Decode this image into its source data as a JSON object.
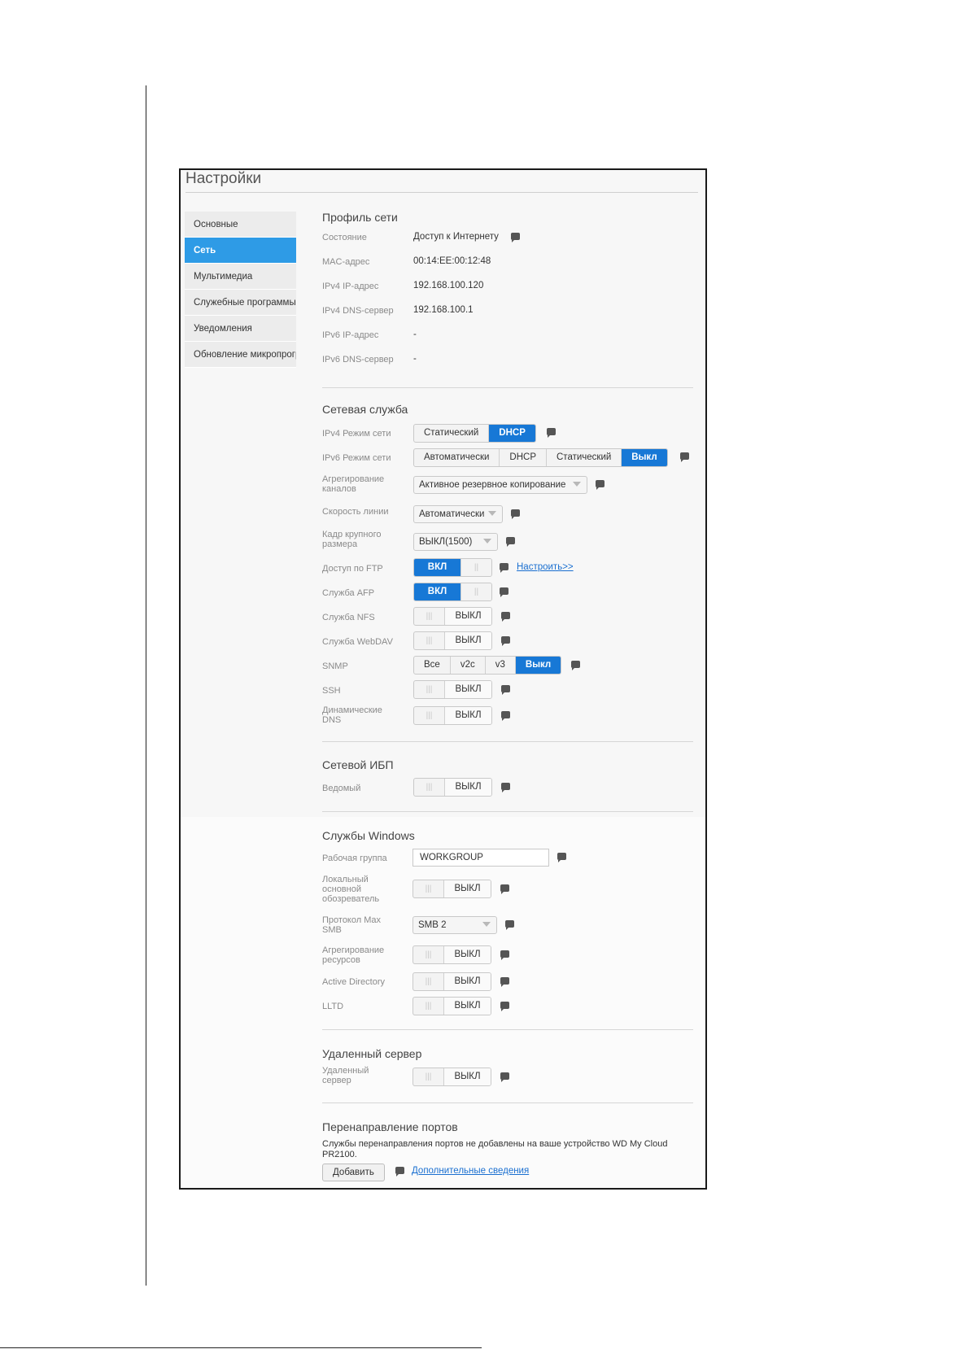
{
  "page_title": "Настройки",
  "sidebar": {
    "items": [
      {
        "label": "Основные"
      },
      {
        "label": "Сеть"
      },
      {
        "label": "Мультимедиа"
      },
      {
        "label": "Служебные программы"
      },
      {
        "label": "Уведомления"
      },
      {
        "label": "Обновление микропрограммы"
      }
    ],
    "active": "Сеть"
  },
  "network_profile": {
    "title": "Профиль сети",
    "rows": [
      {
        "label": "Состояние",
        "value": "Доступ к Интернету"
      },
      {
        "label": "MAC-адрес",
        "value": "00:14:EE:00:12:48"
      },
      {
        "label": "IPv4 IP-адрес",
        "value": "192.168.100.120"
      },
      {
        "label": "IPv4 DNS-сервер",
        "value": "192.168.100.1"
      },
      {
        "label": "IPv6 IP-адрес",
        "value": "-"
      },
      {
        "label": "IPv6 DNS-сервер",
        "value": "-"
      }
    ]
  },
  "network_service": {
    "title": "Сетевая служба",
    "ipv4_mode": {
      "label": "IPv4 Режим сети",
      "options": [
        "Статический",
        "DHCP"
      ],
      "selected": "DHCP"
    },
    "ipv6_mode": {
      "label": "IPv6 Режим сети",
      "options": [
        "Автоматически",
        "DHCP",
        "Статический",
        "Выкл"
      ],
      "selected": "Выкл"
    },
    "link_aggregation": {
      "label": "Агрегирование каналов",
      "value": "Активное резервное копирование"
    },
    "link_speed": {
      "label": "Скорость линии",
      "value": "Автоматически"
    },
    "jumbo_frame": {
      "label": "Кадр крупного размера",
      "value": "ВЫКЛ(1500)"
    },
    "ftp": {
      "label": "Доступ по FTP",
      "state": "ВКЛ",
      "handle": "||",
      "link": "Настроить>>"
    },
    "afp": {
      "label": "Служба AFP",
      "state": "ВКЛ",
      "handle": "||"
    },
    "nfs": {
      "label": "Служба NFS",
      "state": "ВЫКЛ",
      "handle": "|||"
    },
    "webdav": {
      "label": "Служба WebDAV",
      "state": "ВЫКЛ",
      "handle": "|||"
    },
    "snmp": {
      "label": "SNMP",
      "options": [
        "Все",
        "v2c",
        "v3",
        "Выкл"
      ],
      "selected": "Выкл"
    },
    "ssh": {
      "label": "SSH",
      "state": "ВЫКЛ",
      "handle": "|||"
    },
    "ddns": {
      "label": "Динамические DNS",
      "state": "ВЫКЛ",
      "handle": "|||"
    }
  },
  "network_ups": {
    "title": "Сетевой ИБП",
    "slave": {
      "label": "Ведомый",
      "state": "ВЫКЛ",
      "handle": "|||"
    }
  },
  "windows_services": {
    "title": "Службы Windows",
    "workgroup": {
      "label": "Рабочая группа",
      "value": "WORKGROUP"
    },
    "local_master_browser": {
      "label": "Локальный основной обозреватель",
      "state": "ВЫКЛ",
      "handle": "|||"
    },
    "max_smb": {
      "label": "Протокол Max SMB",
      "value": "SMB 2"
    },
    "resource_aggregation": {
      "label": "Агрегирование ресурсов",
      "state": "ВЫКЛ",
      "handle": "|||"
    },
    "active_directory": {
      "label": "Active Directory",
      "state": "ВЫКЛ",
      "handle": "|||"
    },
    "lltd": {
      "label": "LLTD",
      "state": "ВЫКЛ",
      "handle": "|||"
    }
  },
  "remote_server": {
    "title": "Удаленный сервер",
    "toggle": {
      "label": "Удаленный сервер",
      "state": "ВЫКЛ",
      "handle": "|||"
    }
  },
  "port_forwarding": {
    "title": "Перенаправление портов",
    "note": "Службы перенаправления портов не добавлены на ваше устройство WD My Cloud PR2100.",
    "add_button": "Добавить",
    "more_link": "Дополнительные сведения"
  },
  "colors": {
    "accent": "#1778d6",
    "sidebar_active": "#2e9be6",
    "link": "#1a6fd0"
  }
}
